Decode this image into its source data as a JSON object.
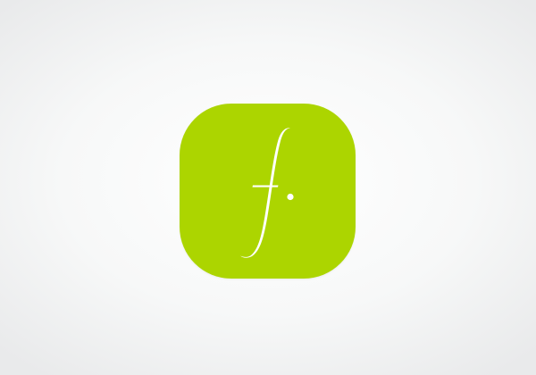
{
  "icon": {
    "name": "app-logo-f-icon",
    "background_color": "#acd500",
    "glyph_color": "#ffffff"
  },
  "page": {
    "background_color": "#f4f5f5"
  }
}
